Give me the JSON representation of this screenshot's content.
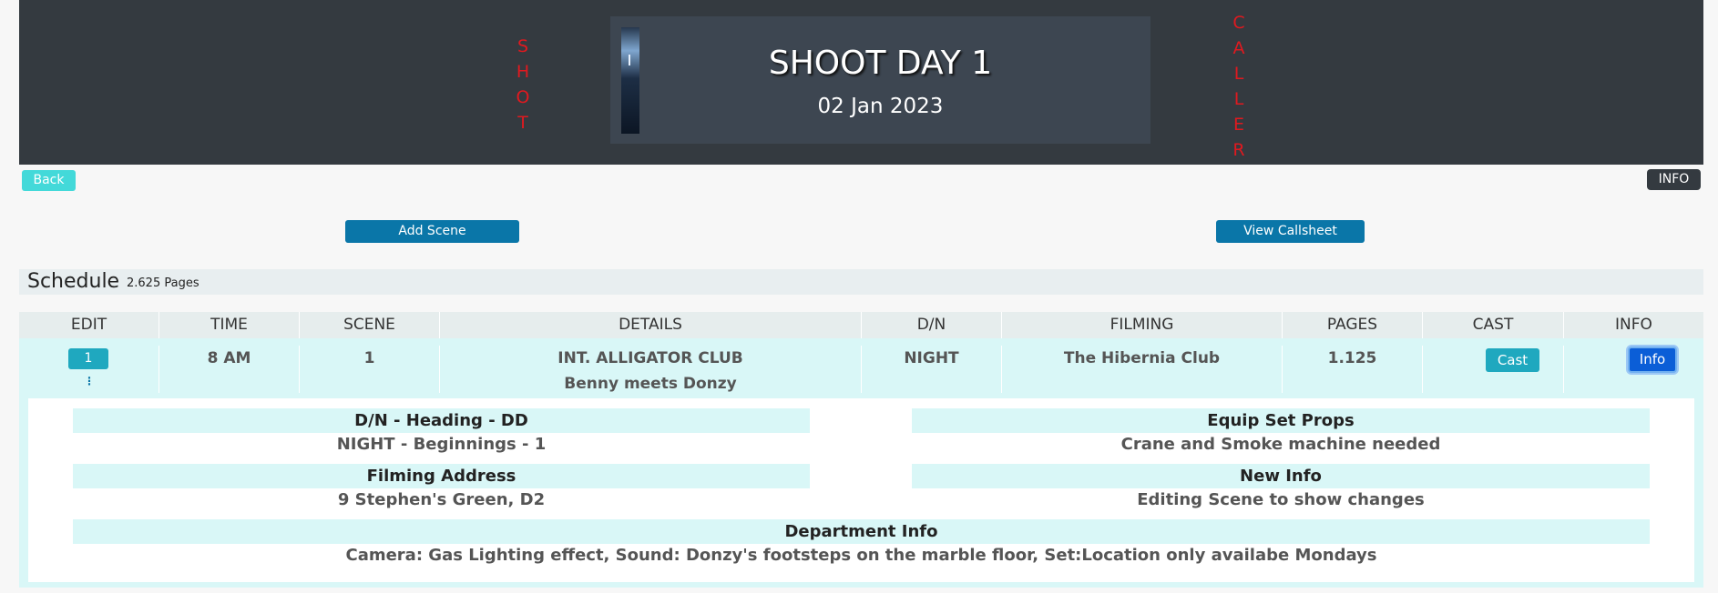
{
  "header": {
    "left_vertical": [
      "S",
      "H",
      "O",
      "T"
    ],
    "right_vertical": [
      "C",
      "A",
      "L",
      "L",
      "E",
      "R"
    ],
    "title": "SHOOT DAY 1",
    "date": "02 Jan 2023"
  },
  "nav": {
    "back_label": "Back",
    "info_label": "INFO"
  },
  "actions": {
    "add_scene_label": "Add Scene",
    "view_callsheet_label": "View Callsheet"
  },
  "schedule": {
    "title": "Schedule",
    "pages": "2.625 Pages"
  },
  "table": {
    "columns": [
      "EDIT",
      "TIME",
      "SCENE",
      "DETAILS",
      "D/N",
      "FILMING",
      "PAGES",
      "CAST",
      "INFO"
    ],
    "row": {
      "edit_label": "1",
      "kebab": "⋮",
      "time": "8 AM",
      "scene": "1",
      "details_line1": "INT. ALLIGATOR CLUB",
      "details_line2": "Benny meets Donzy",
      "dn": "NIGHT",
      "filming": "The Hibernia Club",
      "pages": "1.125",
      "cast_label": "Cast",
      "info_label": "Info"
    }
  },
  "details": {
    "dn_heading_label": "D/N - Heading - DD",
    "dn_heading_value": "NIGHT - Beginnings - 1",
    "equip_label": "Equip Set Props",
    "equip_value": "Crane and Smoke machine needed",
    "address_label": "Filming Address",
    "address_value": "9 Stephen's Green, D2",
    "new_info_label": "New Info",
    "new_info_value": "Editing Scene to show changes",
    "dept_label": "Department Info",
    "dept_value": "Camera: Gas Lighting effect, Sound: Donzy's footsteps on the marble floor, Set:Location only availabe Mondays"
  }
}
